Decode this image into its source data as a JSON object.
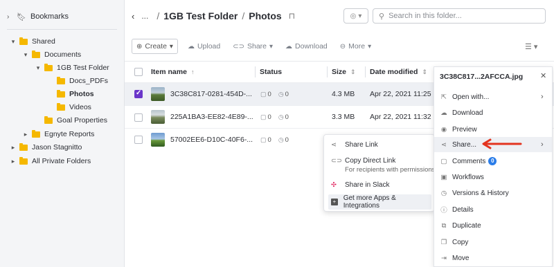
{
  "sidebar": {
    "bookmarks_label": "Bookmarks",
    "tree": [
      {
        "label": "Shared",
        "toggle": "▾"
      },
      {
        "label": "Documents",
        "toggle": "▾"
      },
      {
        "label": "1GB Test Folder",
        "toggle": "▾"
      },
      {
        "label": "Docs_PDFs",
        "toggle": ""
      },
      {
        "label": "Photos",
        "toggle": ""
      },
      {
        "label": "Videos",
        "toggle": ""
      },
      {
        "label": "Goal Properties",
        "toggle": ""
      },
      {
        "label": "Egnyte Reports",
        "toggle": "▸"
      },
      {
        "label": "Jason Stagnitto",
        "toggle": "▸"
      },
      {
        "label": "All Private Folders",
        "toggle": "▸"
      }
    ]
  },
  "header": {
    "ellipsis": "...",
    "separator": "/",
    "crumb_parent": "1GB Test Folder",
    "crumb_current": "Photos",
    "search_placeholder": "Search in this folder..."
  },
  "toolbar": {
    "create": "Create",
    "upload": "Upload",
    "share": "Share",
    "download": "Download",
    "more": "More"
  },
  "table": {
    "columns": {
      "name": "Item name",
      "status": "Status",
      "size": "Size",
      "modified": "Date modified"
    },
    "rows": [
      {
        "name": "3C38C817-0281-454D-...",
        "comments": "0",
        "versions": "0",
        "size": "4.3 MB",
        "date": "Apr 22, 2021 11:25 ...",
        "selected": true
      },
      {
        "name": "225A1BA3-EE82-4E89-...",
        "comments": "0",
        "versions": "0",
        "size": "3.3 MB",
        "date": "Apr 22, 2021 11:32 ...",
        "selected": false
      },
      {
        "name": "57002EE6-D10C-40F6-...",
        "comments": "0",
        "versions": "0",
        "size": "",
        "date": "",
        "selected": false
      }
    ]
  },
  "share_menu": {
    "share_link": "Share Link",
    "copy_direct_link": "Copy Direct Link",
    "copy_direct_link_sub": "For recipients with permissions",
    "share_slack": "Share in Slack",
    "get_more": "Get more Apps & Integrations"
  },
  "panel": {
    "title": "3C38C817...2AFCCA.jpg",
    "items": [
      {
        "label": "Open with...",
        "icon": "external-link-icon"
      },
      {
        "label": "Download",
        "icon": "cloud-download-icon"
      },
      {
        "label": "Preview",
        "icon": "eye-icon"
      },
      {
        "label": "Share...",
        "icon": "share-icon"
      },
      {
        "label": "Comments",
        "icon": "comment-icon",
        "badge": "0"
      },
      {
        "label": "Workflows",
        "icon": "workflow-icon"
      },
      {
        "label": "Versions & History",
        "icon": "history-icon"
      },
      {
        "label": "Details",
        "icon": "info-icon"
      },
      {
        "label": "Duplicate",
        "icon": "duplicate-icon"
      },
      {
        "label": "Copy",
        "icon": "copy-icon"
      },
      {
        "label": "Move",
        "icon": "move-icon"
      }
    ]
  },
  "colors": {
    "accent": "#6a35c9",
    "folder": "#f5b800",
    "badge": "#2b7de9",
    "arrow": "#e3341f"
  }
}
